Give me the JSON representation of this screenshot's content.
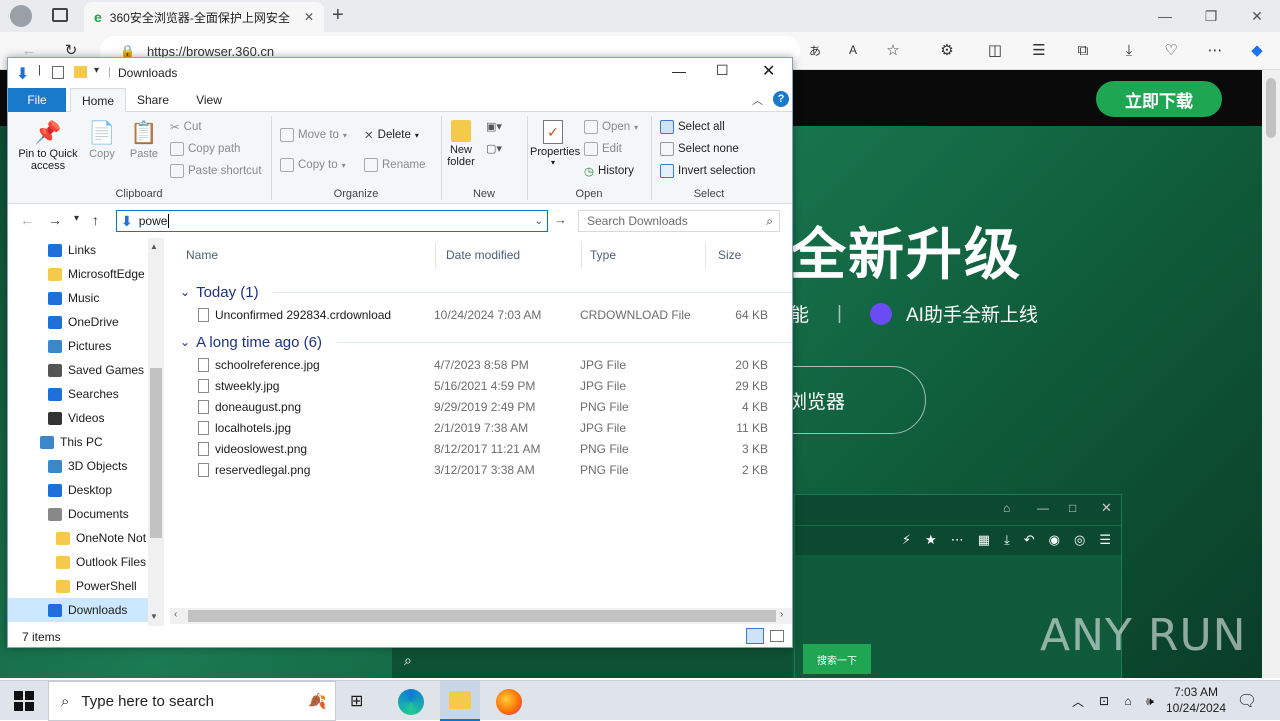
{
  "browser": {
    "tab_title": "360安全浏览器-全面保护上网安全",
    "url": "https://browser.360.cn"
  },
  "webpage": {
    "download_button": "立即下载",
    "hero_title": "全新升级",
    "hero_sub_1": "能",
    "hero_sub_2": "AI助手全新上线",
    "hero_button": "浏览器",
    "search_button": "搜索一下",
    "watermark": "ANY RUN"
  },
  "explorer": {
    "title": "Downloads",
    "ribbon_tabs": [
      "File",
      "Home",
      "Share",
      "View"
    ],
    "clipboard": {
      "pin": "Pin to Quick access",
      "copy": "Copy",
      "paste": "Paste",
      "cut": "Cut",
      "copy_path": "Copy path",
      "paste_shortcut": "Paste shortcut",
      "label": "Clipboard"
    },
    "organize": {
      "move_to": "Move to",
      "copy_to": "Copy to",
      "delete": "Delete",
      "rename": "Rename",
      "label": "Organize"
    },
    "new_group": {
      "new_folder": "New folder",
      "label": "New"
    },
    "open_group": {
      "properties": "Properties",
      "open": "Open",
      "edit": "Edit",
      "history": "History",
      "label": "Open"
    },
    "select_group": {
      "select_all": "Select all",
      "select_none": "Select none",
      "invert": "Invert selection",
      "label": "Select"
    },
    "address_value": "powe",
    "search_placeholder": "Search Downloads",
    "nav": [
      {
        "label": "Links",
        "icon": "link-folder-icon"
      },
      {
        "label": "MicrosoftEdge",
        "icon": "folder-icon"
      },
      {
        "label": "Music",
        "icon": "music-icon"
      },
      {
        "label": "OneDrive",
        "icon": "onedrive-icon"
      },
      {
        "label": "Pictures",
        "icon": "pictures-icon"
      },
      {
        "label": "Saved Games",
        "icon": "games-icon"
      },
      {
        "label": "Searches",
        "icon": "search-folder-icon"
      },
      {
        "label": "Videos",
        "icon": "videos-icon"
      },
      {
        "label": "This PC",
        "icon": "pc-icon"
      },
      {
        "label": "3D Objects",
        "icon": "3d-objects-icon"
      },
      {
        "label": "Desktop",
        "icon": "desktop-icon"
      },
      {
        "label": "Documents",
        "icon": "documents-icon"
      },
      {
        "label": "OneNote Not",
        "icon": "folder-icon"
      },
      {
        "label": "Outlook Files",
        "icon": "folder-icon"
      },
      {
        "label": "PowerShell",
        "icon": "folder-icon"
      },
      {
        "label": "Downloads",
        "icon": "downloads-icon"
      }
    ],
    "columns": {
      "name": "Name",
      "date": "Date modified",
      "type": "Type",
      "size": "Size"
    },
    "groups": [
      {
        "label": "Today (1)",
        "files": [
          {
            "name": "Unconfirmed 292834.crdownload",
            "date": "10/24/2024 7:03 AM",
            "type": "CRDOWNLOAD File",
            "size": "64 KB"
          }
        ]
      },
      {
        "label": "A long time ago (6)",
        "files": [
          {
            "name": "schoolreference.jpg",
            "date": "4/7/2023 8:58 PM",
            "type": "JPG File",
            "size": "20 KB"
          },
          {
            "name": "stweekly.jpg",
            "date": "5/16/2021 4:59 PM",
            "type": "JPG File",
            "size": "29 KB"
          },
          {
            "name": "doneaugust.png",
            "date": "9/29/2019 2:49 PM",
            "type": "PNG File",
            "size": "4 KB"
          },
          {
            "name": "localhotels.jpg",
            "date": "2/1/2019 7:38 AM",
            "type": "JPG File",
            "size": "11 KB"
          },
          {
            "name": "videoslowest.png",
            "date": "8/12/2017 11:21 AM",
            "type": "PNG File",
            "size": "3 KB"
          },
          {
            "name": "reservedlegal.png",
            "date": "3/12/2017 3:38 AM",
            "type": "PNG File",
            "size": "2 KB"
          }
        ]
      }
    ],
    "status": "7 items"
  },
  "taskbar": {
    "search_placeholder": "Type here to search",
    "time": "7:03 AM",
    "date": "10/24/2024"
  }
}
